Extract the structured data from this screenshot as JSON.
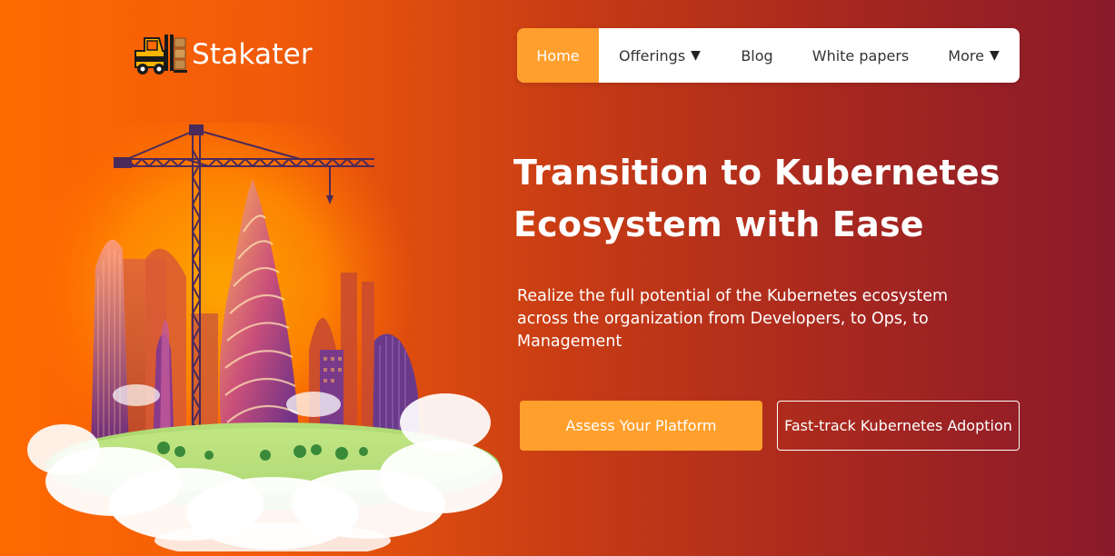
{
  "brand": {
    "name": "Stakater",
    "logo_icon": "forklift-icon"
  },
  "nav": {
    "items": [
      {
        "label": "Home",
        "active": true
      },
      {
        "label": "Offerings",
        "caret": "▼"
      },
      {
        "label": "Blog"
      },
      {
        "label": "White papers"
      },
      {
        "label": "More",
        "caret": "▼"
      }
    ]
  },
  "hero": {
    "title_line1": "Transition to Kubernetes",
    "title_line2": "Ecosystem with Ease",
    "subtitle": "Realize the full potential of the Kubernetes ecosystem across the organization from Developers, to Ops, to Management",
    "primary_cta": "Assess Your Platform",
    "secondary_cta": "Fast-track Kubernetes Adoption"
  },
  "colors": {
    "accent": "#ffa02c",
    "bg_left": "#ff6a00",
    "bg_right": "#8a1a2a",
    "text": "#ffffff"
  }
}
